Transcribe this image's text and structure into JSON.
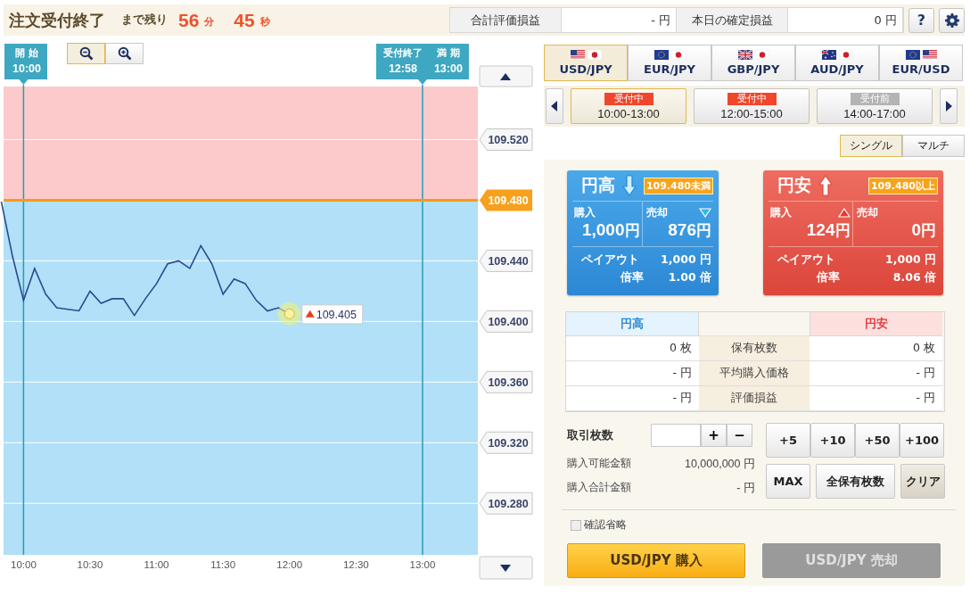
{
  "header": {
    "status": "注文受付終了",
    "remaining_label": "まで残り",
    "minutes": "56",
    "minutes_unit": "分",
    "seconds": "45",
    "seconds_unit": "秒",
    "summary": [
      {
        "label": "合計評価損益",
        "value": "- 円"
      },
      {
        "label": "本日の確定損益",
        "value": "0 円"
      }
    ],
    "help": "?"
  },
  "chart": {
    "zoom_buttons": [
      {
        "kind": "zoom-out",
        "selected": true
      },
      {
        "kind": "zoom-in",
        "selected": false
      }
    ],
    "markers": [
      {
        "labels": [
          {
            "title": "開 始",
            "time": "10:00"
          }
        ]
      },
      {
        "labels": [
          {
            "title": "受付終了",
            "time": "12:58"
          },
          {
            "title": "満 期",
            "time": "13:00"
          }
        ]
      }
    ],
    "current_price": "109.405",
    "threshold_label": "109.480",
    "chart_data": {
      "type": "line",
      "categories": [
        null,
        null,
        "10:00",
        null,
        null,
        null,
        null,
        null,
        "10:30",
        null,
        null,
        null,
        null,
        null,
        "11:00",
        null,
        null,
        null,
        null,
        null,
        "11:30",
        null,
        null,
        null,
        null,
        null,
        "12:00",
        null,
        null,
        null,
        null,
        null,
        "12:30",
        null,
        null,
        null,
        null,
        null,
        "13:00",
        null,
        null,
        null,
        null
      ],
      "series": [
        {
          "color": "#2b4a8f",
          "values": [
            109.479,
            109.443,
            109.414,
            109.435,
            109.418,
            109.409,
            109.408,
            109.407,
            109.42,
            109.412,
            109.415,
            109.415,
            109.404,
            109.415,
            109.425,
            109.438,
            109.44,
            109.435,
            109.45,
            109.438,
            109.418,
            109.428,
            109.425,
            109.414,
            109.407,
            109.409,
            109.405,
            null,
            null,
            null,
            null,
            null,
            null,
            null,
            null,
            null,
            null,
            null,
            null,
            null,
            null,
            null,
            null
          ]
        }
      ],
      "ylim": [
        109.246,
        109.555
      ],
      "yticks": [
        {
          "value": 109.52,
          "label": "109.520"
        },
        {
          "value": 109.44,
          "label": "109.440"
        },
        {
          "value": 109.4,
          "label": "109.400"
        },
        {
          "value": 109.36,
          "label": "109.360"
        },
        {
          "value": 109.32,
          "label": "109.320"
        },
        {
          "value": 109.28,
          "label": "109.280"
        }
      ],
      "grid": true,
      "ref_lines": [
        {
          "axis": "y",
          "value": 109.48,
          "color": "#f59a1a"
        }
      ]
    }
  },
  "pairs": [
    {
      "label": "USD/JPY",
      "selected": true
    },
    {
      "label": "EUR/JPY",
      "selected": false
    },
    {
      "label": "GBP/JPY",
      "selected": false
    },
    {
      "label": "AUD/JPY",
      "selected": false
    },
    {
      "label": "EUR/USD",
      "selected": false
    }
  ],
  "sessions": [
    {
      "status": "受付中",
      "open": true,
      "time": "10:00-13:00",
      "selected": true
    },
    {
      "status": "受付中",
      "open": true,
      "time": "12:00-15:00",
      "selected": false
    },
    {
      "status": "受付前",
      "open": false,
      "time": "14:00-17:00",
      "selected": false
    }
  ],
  "modes": [
    {
      "label": "シングル",
      "selected": true
    },
    {
      "label": "マルチ",
      "selected": false
    }
  ],
  "options": [
    {
      "kind": "high",
      "title": "円高",
      "condition": "109.480未満",
      "buy_label": "購入",
      "buy": {
        "amount": "1,000",
        "unit": "円"
      },
      "sell_label": "売却",
      "sell": {
        "amount": "876",
        "unit": "円"
      },
      "payout_label": "ペイアウト",
      "payout": "1,000 円",
      "rate_label": "倍率",
      "rate": "1.00 倍"
    },
    {
      "kind": "low",
      "title": "円安",
      "condition": "109.480以上",
      "buy_label": "購入",
      "buy": {
        "amount": "124",
        "unit": "円"
      },
      "sell_label": "売却",
      "sell": {
        "amount": "0",
        "unit": "円"
      },
      "payout_label": "ペイアウト",
      "payout": "1,000 円",
      "rate_label": "倍率",
      "rate": "8.06 倍"
    }
  ],
  "positions": {
    "high_header": "円高",
    "low_header": "円安",
    "rows": [
      {
        "label": "保有枚数",
        "high": "0 枚",
        "low": "0 枚"
      },
      {
        "label": "平均購入価格",
        "high": "- 円",
        "low": "- 円"
      },
      {
        "label": "評価損益",
        "high": "- 円",
        "low": "- 円"
      }
    ]
  },
  "order": {
    "quantity_label": "取引枚数",
    "plus": "+",
    "minus": "−",
    "available_label": "購入可能金額",
    "available": "10,000,000 円",
    "total_label": "購入合計金額",
    "total": "- 円",
    "add_buttons": [
      "+5",
      "+10",
      "+50",
      "+100"
    ],
    "other_buttons": [
      {
        "label": "MAX",
        "kind": "normal"
      },
      {
        "label": "全保有枚数",
        "kind": "normal"
      },
      {
        "label": "クリア",
        "kind": "clear"
      }
    ],
    "skip_confirm": {
      "label": "確認省略",
      "checked": false
    }
  },
  "actions": [
    {
      "label": "USD/JPY 購入",
      "kind": "buy",
      "disabled": false
    },
    {
      "label": "USD/JPY 売却",
      "kind": "sell",
      "disabled": true
    }
  ]
}
